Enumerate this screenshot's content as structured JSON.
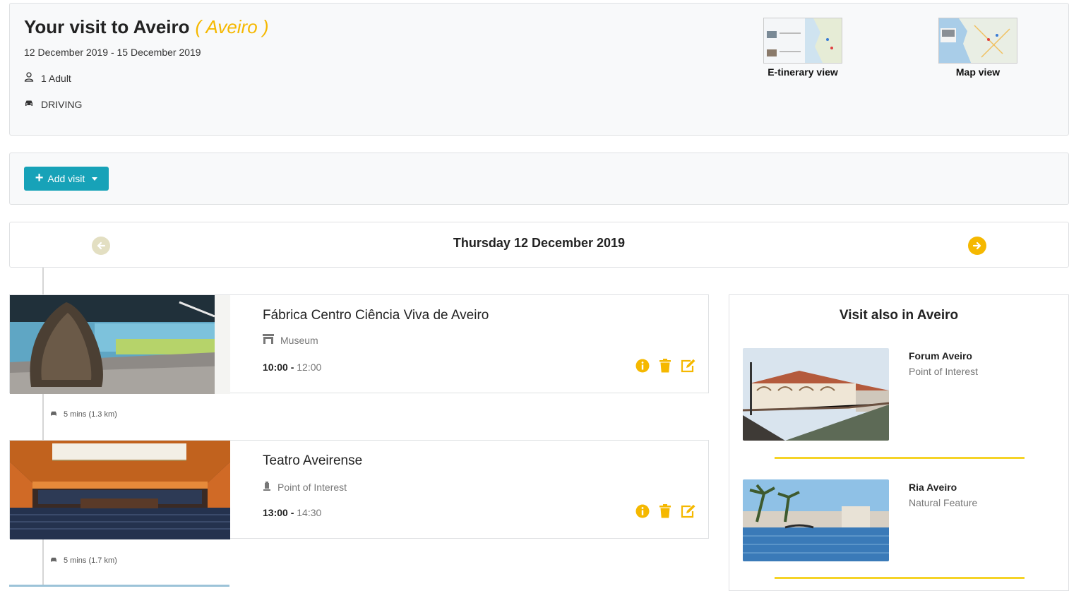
{
  "header": {
    "title": "Your visit to Aveiro",
    "city": "( Aveiro )",
    "dates": "12 December 2019 - 15 December 2019",
    "travellers": "1 Adult",
    "travel_mode": "DRIVING",
    "views": [
      {
        "label": "E-tinerary view",
        "icon": "etinerary-thumbnail"
      },
      {
        "label": "Map view",
        "icon": "map-thumbnail"
      }
    ]
  },
  "toolbar": {
    "add_label": "Add visit"
  },
  "day": {
    "title": "Thursday 12 December 2019"
  },
  "visits": [
    {
      "name": "Fábrica Centro Ciência Viva de Aveiro",
      "type": "Museum",
      "type_icon": "museum-icon",
      "start": "10:00",
      "end": "12:00"
    },
    {
      "name": "Teatro Aveirense",
      "type": "Point of Interest",
      "type_icon": "point-of-interest-icon",
      "start": "13:00",
      "end": "14:30"
    }
  ],
  "travel": [
    {
      "text": "5 mins (1.3 km)"
    },
    {
      "text": "5 mins (1.7 km)"
    }
  ],
  "suggestions": {
    "title": "Visit also in Aveiro",
    "items": [
      {
        "name": "Forum Aveiro",
        "type": "Point of Interest"
      },
      {
        "name": "Ria Aveiro",
        "type": "Natural Feature"
      }
    ]
  },
  "colors": {
    "accent": "#f5b800",
    "button": "#17a2b8",
    "divider": "#f5d327"
  }
}
